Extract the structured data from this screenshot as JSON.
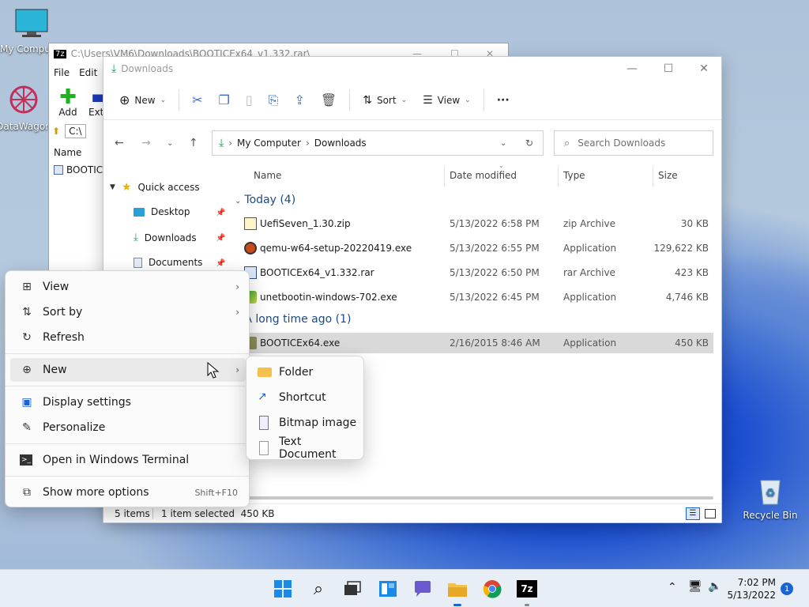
{
  "desktop": {
    "icons": [
      {
        "label": "My Computer"
      },
      {
        "label": "DataWagon"
      },
      {
        "label": "Recycle Bin"
      }
    ]
  },
  "sevenzip": {
    "title": "C:\\Users\\VM6\\Downloads\\BOOTICEx64_v1.332.rar\\",
    "menu": [
      "File",
      "Edit"
    ],
    "tools": [
      "Add",
      "Extra"
    ],
    "path_prefix": "C:\\",
    "col_name": "Name",
    "row_name": "BOOTICE"
  },
  "explorer": {
    "title": "Downloads",
    "toolbar": {
      "new": "New",
      "sort": "Sort",
      "view": "View",
      "more": "···"
    },
    "address": {
      "crumbs": [
        "My Computer",
        "Downloads"
      ],
      "search_placeholder": "Search Downloads"
    },
    "nav": {
      "quick_access": "Quick access",
      "items": [
        "Desktop",
        "Downloads",
        "Documents"
      ]
    },
    "columns": {
      "name": "Name",
      "date": "Date modified",
      "type": "Type",
      "size": "Size"
    },
    "groups": [
      {
        "label": "Today (4)",
        "files": [
          {
            "name": "UefiSeven_1.30.zip",
            "date": "5/13/2022 6:58 PM",
            "type": "zip Archive",
            "size": "30 KB"
          },
          {
            "name": "qemu-w64-setup-20220419.exe",
            "date": "5/13/2022 6:55 PM",
            "type": "Application",
            "size": "129,622 KB"
          },
          {
            "name": "BOOTICEx64_v1.332.rar",
            "date": "5/13/2022 6:50 PM",
            "type": "rar Archive",
            "size": "423 KB"
          },
          {
            "name": "unetbootin-windows-702.exe",
            "date": "5/13/2022 6:45 PM",
            "type": "Application",
            "size": "4,746 KB"
          }
        ]
      },
      {
        "label": "A long time ago (1)",
        "files": [
          {
            "name": "BOOTICEx64.exe",
            "date": "2/16/2015 8:46 AM",
            "type": "Application",
            "size": "450 KB"
          }
        ]
      }
    ],
    "status": {
      "count": "5 items",
      "selected": "1 item selected  450 KB"
    }
  },
  "context_menu": {
    "items": {
      "view": "View",
      "sort_by": "Sort by",
      "refresh": "Refresh",
      "new": "New",
      "display_settings": "Display settings",
      "personalize": "Personalize",
      "terminal": "Open in Windows Terminal",
      "more_options": "Show more options",
      "more_options_shortcut": "Shift+F10"
    },
    "submenu": [
      "Folder",
      "Shortcut",
      "Bitmap image",
      "Text Document"
    ]
  },
  "taskbar": {
    "time": "7:02 PM",
    "date": "5/13/2022",
    "notifications": "1"
  },
  "colors": {
    "accent": "#1a63d4",
    "folder": "#f2c14e",
    "selected_row": "#d9d9d9"
  }
}
